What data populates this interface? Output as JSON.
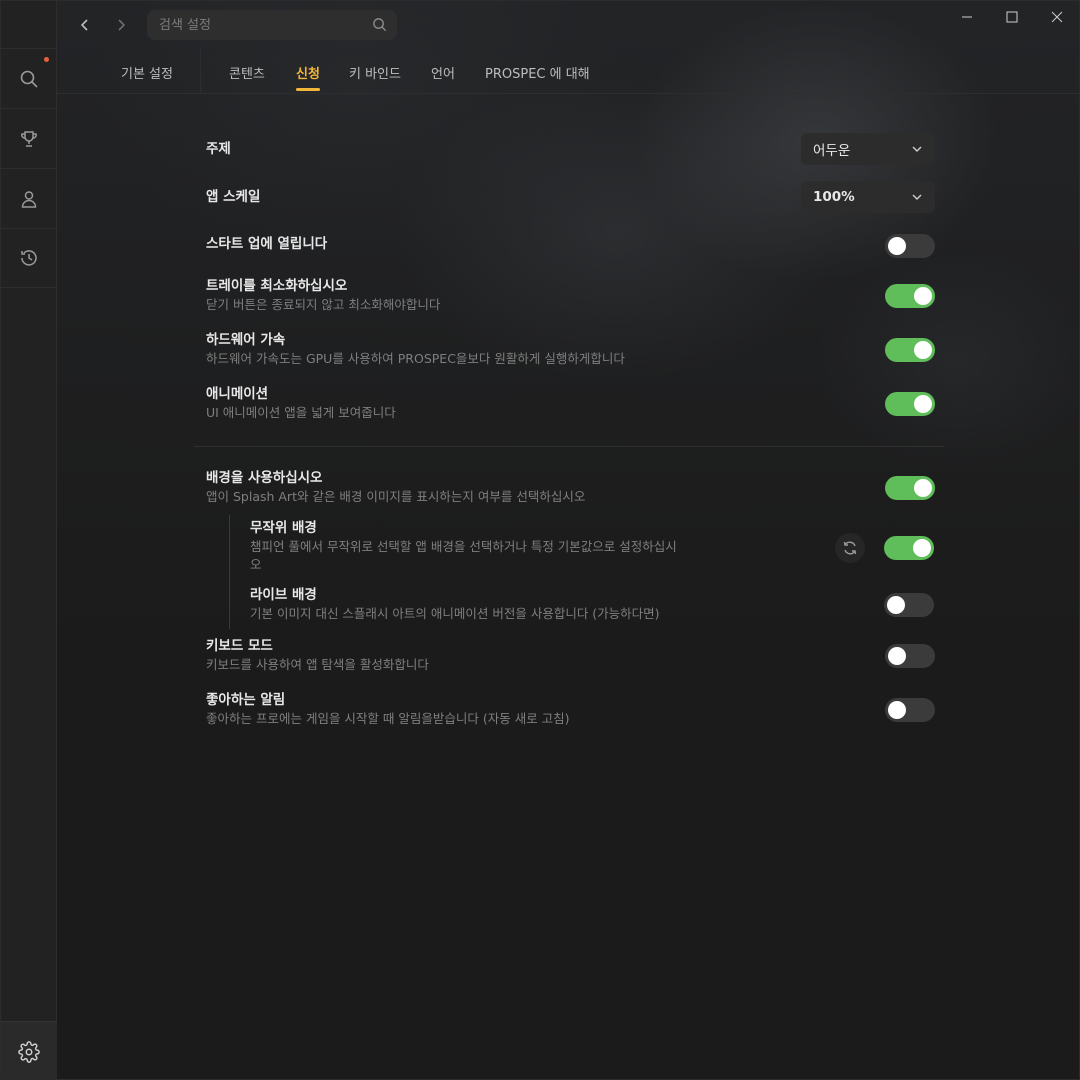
{
  "search": {
    "placeholder": "검색 설정"
  },
  "tabs": [
    {
      "label": "기본 설정"
    },
    {
      "label": "콘텐츠"
    },
    {
      "label": "신청",
      "active": true
    },
    {
      "label": "키 바인드"
    },
    {
      "label": "언어"
    },
    {
      "label": "PROSPEC 에 대해"
    }
  ],
  "settings": {
    "theme": {
      "title": "주제",
      "value": "어두운"
    },
    "scale": {
      "title": "앱 스케일",
      "value": "100%"
    },
    "startup": {
      "title": "스타트 업에 열립니다",
      "enabled": false
    },
    "tray": {
      "title": "트레이를 최소화하십시오",
      "desc": "닫기 버튼은 종료되지 않고 최소화해야합니다",
      "enabled": true
    },
    "hwaccel": {
      "title": "하드웨어 가속",
      "desc": "하드웨어 가속도는 GPU를 사용하여 PROSPEC을보다 원활하게 실행하게합니다",
      "enabled": true
    },
    "animation": {
      "title": "애니메이션",
      "desc": "UI 애니메이션 앱을 넓게 보여줍니다",
      "enabled": true
    },
    "background": {
      "title": "배경을 사용하십시오",
      "desc": "앱이 Splash Art와 같은 배경 이미지를 표시하는지 여부를 선택하십시오",
      "enabled": true
    },
    "random_bg": {
      "title": "무작위 배경",
      "desc1": "챔피언 풀에서 무작위로 선택할 앱 배경을 선택하거나 특정 기본값으로 설정하십시",
      "desc2": "오",
      "enabled": true
    },
    "live_bg": {
      "title": "라이브 배경",
      "desc": "기본 이미지 대신 스플래시 아트의 애니메이션 버전을 사용합니다 (가능하다면)",
      "enabled": false
    },
    "keyboard": {
      "title": "키보드 모드",
      "desc": "키보드를 사용하여 앱 탐색을 활성화합니다",
      "enabled": false
    },
    "fav_alert": {
      "title": "좋아하는 알림",
      "desc": "좋아하는 프로에는 게임을 시작할 때 알림을받습니다 (자동 새로 고침)",
      "enabled": false
    }
  },
  "colors": {
    "accent": "#f2b63a",
    "toggle_on": "#5fbd5a",
    "notification": "#e8613c"
  }
}
